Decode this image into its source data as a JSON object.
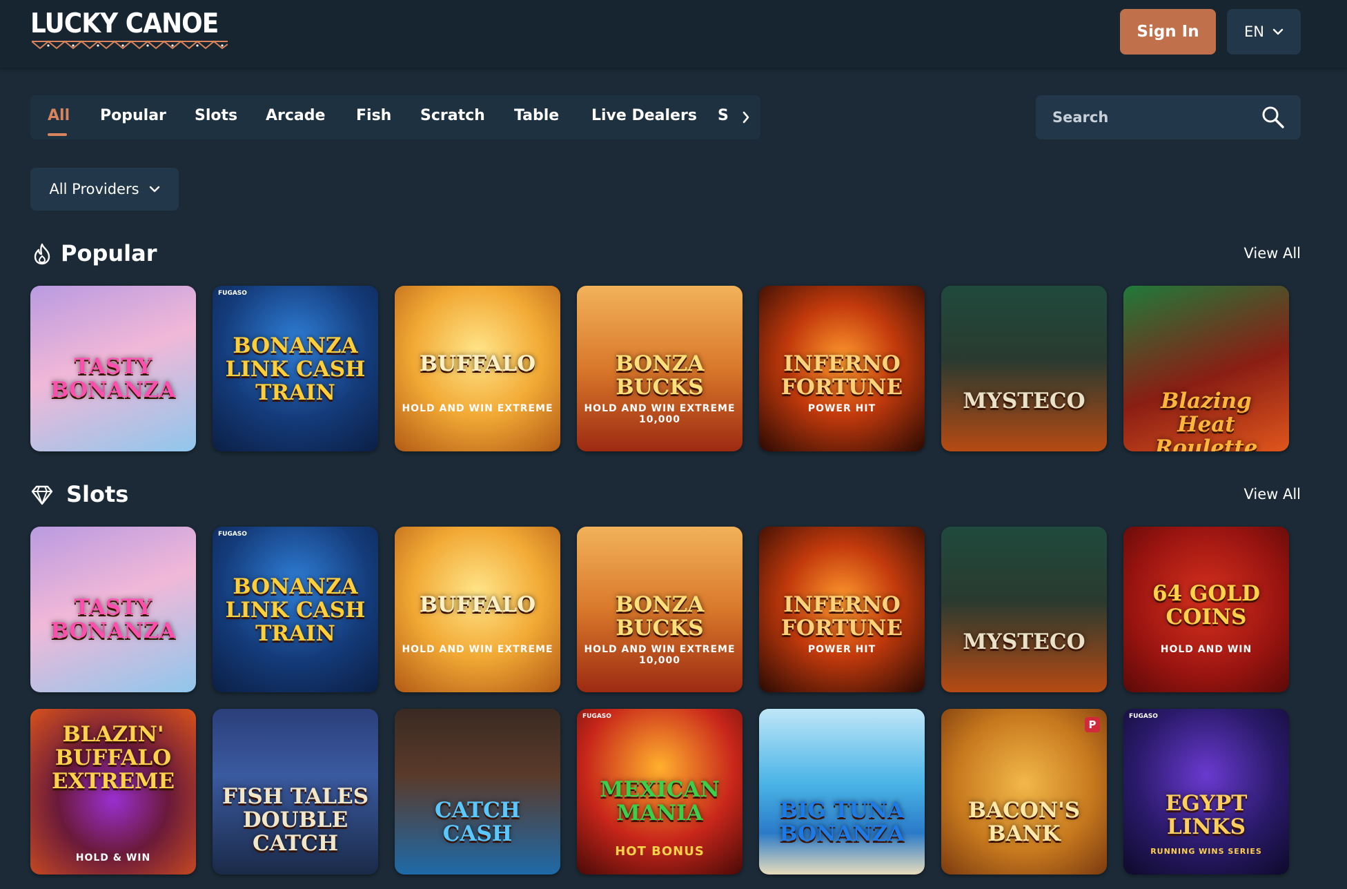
{
  "header": {
    "logo_text": "LUCKY CANOE",
    "sign_in_label": "Sign In",
    "language": "EN"
  },
  "nav": {
    "tabs": [
      {
        "label": "All",
        "active": true
      },
      {
        "label": "Popular"
      },
      {
        "label": "Slots"
      },
      {
        "label": "Arcade"
      },
      {
        "label": "Fish"
      },
      {
        "label": "Scratch"
      },
      {
        "label": "Table"
      },
      {
        "label": "Live Dealers"
      },
      {
        "label": "S"
      }
    ]
  },
  "search": {
    "placeholder": "Search"
  },
  "filters": {
    "providers_label": "All Providers"
  },
  "sections": {
    "popular": {
      "title": "Popular",
      "view_all": "View All",
      "icon": "flame-icon",
      "games": [
        {
          "title": "TASTY BONANZA"
        },
        {
          "title": "BONANZA LINK CASH TRAIN",
          "provider": "FUGASO"
        },
        {
          "title": "BUFFALO",
          "sub": "HOLD AND WIN EXTREME"
        },
        {
          "title": "BONZA BUCKS",
          "sub": "HOLD AND WIN EXTREME 10,000"
        },
        {
          "title": "INFERNO FORTUNE",
          "sub": "POWER HIT"
        },
        {
          "title": "MYSTECO"
        },
        {
          "title": "Blazing Heat Roulette"
        }
      ]
    },
    "slots": {
      "title": "Slots",
      "view_all": "View All",
      "icon": "diamond-icon",
      "games": [
        {
          "title": "TASTY BONANZA"
        },
        {
          "title": "BONANZA LINK CASH TRAIN",
          "provider": "FUGASO"
        },
        {
          "title": "BUFFALO",
          "sub": "HOLD AND WIN EXTREME"
        },
        {
          "title": "BONZA BUCKS",
          "sub": "HOLD AND WIN EXTREME 10,000"
        },
        {
          "title": "INFERNO FORTUNE",
          "sub": "POWER HIT"
        },
        {
          "title": "MYSTECO"
        },
        {
          "title": "64 GOLD COINS",
          "sub": "HOLD AND WIN"
        },
        {
          "title": "BLAZIN' BUFFALO EXTREME",
          "sub": "HOLD & WIN"
        },
        {
          "title": "FISH TALES DOUBLE CATCH"
        },
        {
          "title": "CATCH CASH"
        },
        {
          "title": "MEXICAN MANIA",
          "sub": "HOT BONUS",
          "provider": "FUGASO"
        },
        {
          "title": "BIG TUNA BONANZA"
        },
        {
          "title": "BACON'S BANK",
          "badge": "P"
        },
        {
          "title": "EGYPT LINKS",
          "sub": "RUNNING WINS SERIES",
          "provider": "FUGASO"
        }
      ]
    }
  },
  "colors": {
    "page_bg": "#1b2a36",
    "header_bg": "#172530",
    "accent": "#c0704a",
    "active_tab": "#d9845c",
    "control_bg": "#22374a"
  }
}
